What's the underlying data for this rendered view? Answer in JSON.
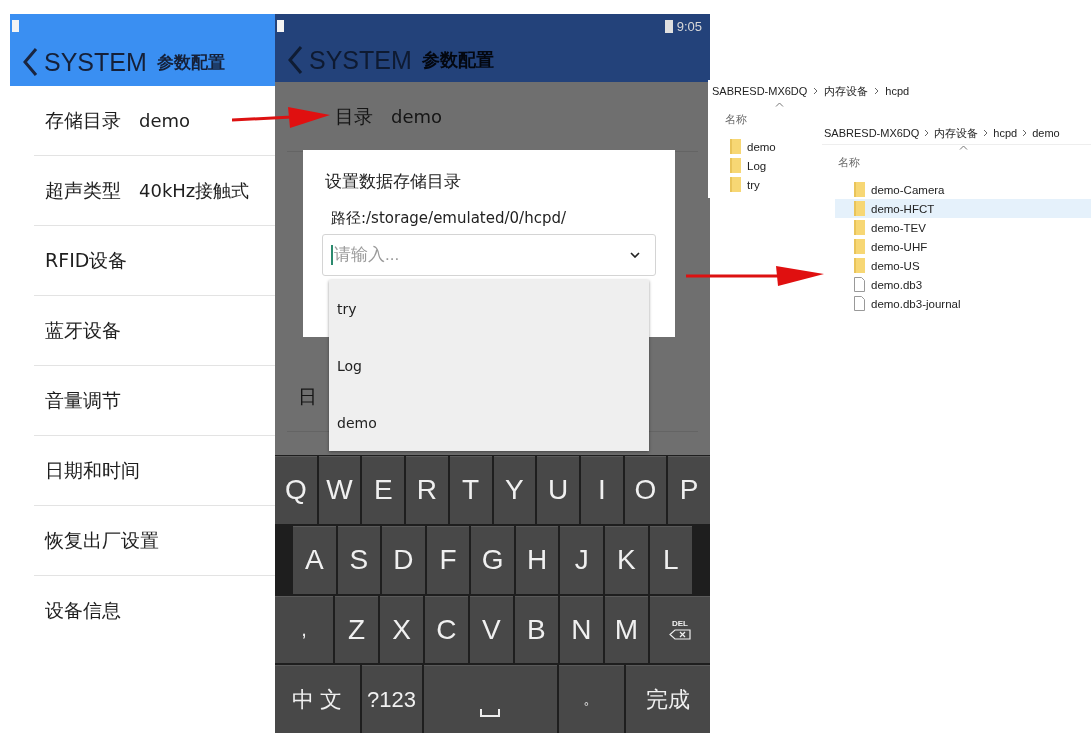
{
  "left_screen": {
    "title": "SYSTEM",
    "subtitle": "参数配置",
    "settings": [
      {
        "label": "存储目录",
        "value": "demo"
      },
      {
        "label": "超声类型",
        "value": "40kHz接触式"
      },
      {
        "label": "RFID设备"
      },
      {
        "label": "蓝牙设备"
      },
      {
        "label": "音量调节"
      },
      {
        "label": "日期和时间"
      },
      {
        "label": "恢复出厂设置"
      },
      {
        "label": "设备信息"
      }
    ]
  },
  "middle_screen": {
    "status_bar": {
      "time": "9:05"
    },
    "title": "SYSTEM",
    "subtitle": "参数配置",
    "settings": [
      {
        "label": "目录",
        "value": "demo"
      },
      {
        "label": "日"
      }
    ],
    "dialog": {
      "title": "设置数据存储目录",
      "path_label": "路径:/storage/emulated/0/hcpd/",
      "combo": {
        "placeholder": "请输入...",
        "expanded": true
      },
      "options": [
        "try",
        "Log",
        "demo"
      ]
    },
    "keyboard": {
      "rows": [
        {
          "keys": [
            {
              "kind": "letter",
              "label": "Q"
            },
            {
              "kind": "letter",
              "label": "W"
            },
            {
              "kind": "letter",
              "label": "E"
            },
            {
              "kind": "letter",
              "label": "R"
            },
            {
              "kind": "letter",
              "label": "T"
            },
            {
              "kind": "letter",
              "label": "Y"
            },
            {
              "kind": "letter",
              "label": "U"
            },
            {
              "kind": "letter",
              "label": "I"
            },
            {
              "kind": "letter",
              "label": "O"
            },
            {
              "kind": "letter",
              "label": "P"
            }
          ]
        },
        {
          "keys": [
            {
              "kind": "letter",
              "label": "A"
            },
            {
              "kind": "letter",
              "label": "S"
            },
            {
              "kind": "letter",
              "label": "D"
            },
            {
              "kind": "letter",
              "label": "F"
            },
            {
              "kind": "letter",
              "label": "G"
            },
            {
              "kind": "letter",
              "label": "H"
            },
            {
              "kind": "letter",
              "label": "J"
            },
            {
              "kind": "letter",
              "label": "K"
            },
            {
              "kind": "letter",
              "label": "L"
            }
          ]
        },
        {
          "keys": [
            {
              "kind": "wide",
              "label": ","
            },
            {
              "kind": "letter",
              "label": "Z"
            },
            {
              "kind": "letter",
              "label": "X"
            },
            {
              "kind": "letter",
              "label": "C"
            },
            {
              "kind": "letter",
              "label": "V"
            },
            {
              "kind": "letter",
              "label": "B"
            },
            {
              "kind": "letter",
              "label": "N"
            },
            {
              "kind": "letter",
              "label": "M"
            },
            {
              "kind": "delete",
              "label": "DEL"
            }
          ]
        },
        {
          "keys": [
            {
              "kind": "function",
              "label": "中 文"
            },
            {
              "kind": "symbols",
              "label": "?123"
            },
            {
              "kind": "space"
            },
            {
              "kind": "wide",
              "label": "。"
            },
            {
              "kind": "function",
              "label": "完成"
            }
          ]
        }
      ]
    }
  },
  "explorer_windows": [
    {
      "breadcrumb": [
        "SABRESD-MX6DQ",
        "内存设备",
        "hcpd"
      ],
      "column": "名称",
      "items": [
        {
          "name": "demo",
          "kind": "folder",
          "selected": false
        },
        {
          "name": "Log",
          "kind": "folder",
          "selected": false
        },
        {
          "name": "try",
          "kind": "folder",
          "selected": false
        }
      ]
    },
    {
      "breadcrumb": [
        "SABRESD-MX6DQ",
        "内存设备",
        "hcpd",
        "demo"
      ],
      "column": "名称",
      "items": [
        {
          "name": "demo-Camera",
          "kind": "folder",
          "selected": false
        },
        {
          "name": "demo-HFCT",
          "kind": "folder",
          "selected": true
        },
        {
          "name": "demo-TEV",
          "kind": "folder",
          "selected": false
        },
        {
          "name": "demo-UHF",
          "kind": "folder",
          "selected": false
        },
        {
          "name": "demo-US",
          "kind": "folder",
          "selected": false
        },
        {
          "name": "demo.db3",
          "kind": "file",
          "selected": false
        },
        {
          "name": "demo.db3-journal",
          "kind": "file",
          "selected": false
        }
      ]
    }
  ]
}
